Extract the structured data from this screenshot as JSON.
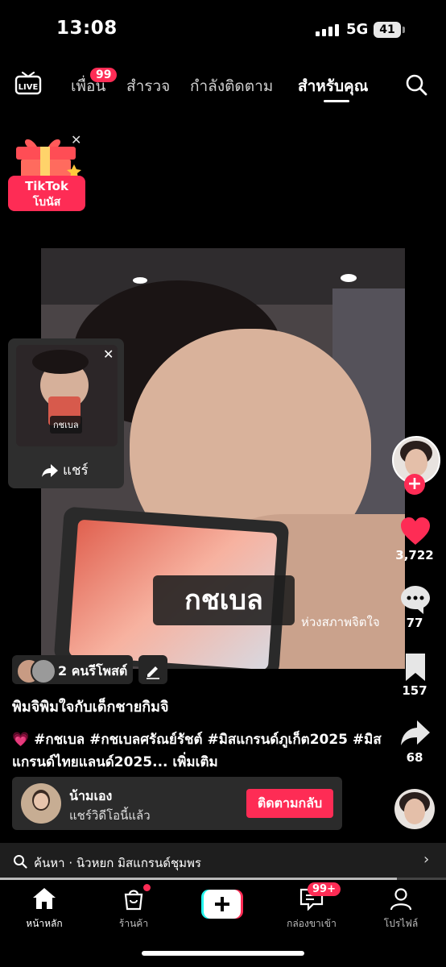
{
  "status": {
    "time": "13:08",
    "network": "5G",
    "battery": "41"
  },
  "nav": {
    "live_label": "LIVE",
    "tabs": [
      {
        "label": "เพื่อน",
        "badge": "99"
      },
      {
        "label": "สำรวจ"
      },
      {
        "label": "กำลังติดตาม"
      },
      {
        "label": "สำหรับคุณ",
        "active": true
      }
    ]
  },
  "bonus": {
    "line1": "TikTok",
    "line2": "โบนัส"
  },
  "video": {
    "caption": "กชเบล",
    "note": "ห่วงสภาพจิตใจ"
  },
  "mini_share": {
    "caption": "กชเบล",
    "share_label": "แชร์"
  },
  "actions": {
    "likes": "3,722",
    "comments": "77",
    "saves": "157",
    "shares": "68"
  },
  "post": {
    "reposters": "2 คนรีโพสต์",
    "title": "พิมจิพิมใจกับเด็กชายกิมจิ",
    "hashtags": "#กชเบล #กชเบลศรัณย์รัชต์ #มิสแกรนด์ภูเก็ต2025 #มิสแกรนด์ไทยแลนด์2025...",
    "more": "เพิ่มเติม"
  },
  "share_card": {
    "name": "น้ามเอง",
    "subtitle": "แชร์วิดีโอนี้แล้ว",
    "button": "ติดตามกลับ"
  },
  "search": {
    "text": "ค้นหา · นิวหยก มิสแกรนด์ชุมพร"
  },
  "playback": {
    "progress": 0.89
  },
  "bottom_nav": [
    {
      "label": "หน้าหลัก",
      "active": true
    },
    {
      "label": "ร้านค้า"
    },
    {
      "label": ""
    },
    {
      "label": "กล่องขาเข้า",
      "badge": "99+"
    },
    {
      "label": "โปรไฟล์"
    }
  ],
  "colors": {
    "accent": "#fe2c55",
    "bg": "#000000"
  }
}
